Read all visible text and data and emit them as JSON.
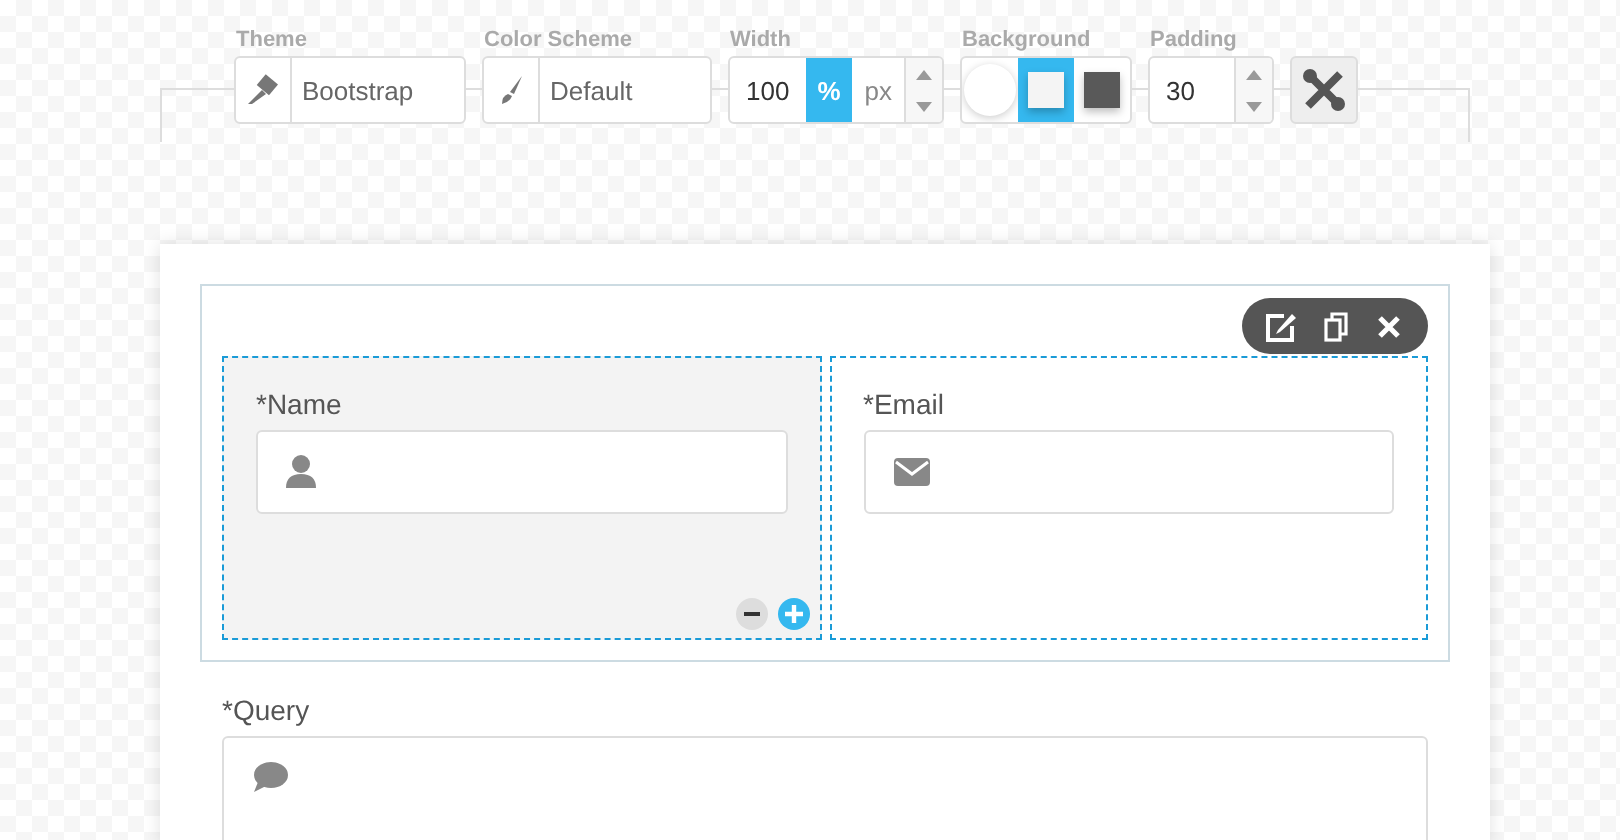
{
  "toolbar": {
    "theme": {
      "label": "Theme",
      "value": "Bootstrap"
    },
    "color_scheme": {
      "label": "Color Scheme",
      "value": "Default"
    },
    "width": {
      "label": "Width",
      "value": "100",
      "units": [
        {
          "label": "%",
          "selected": true
        },
        {
          "label": "px",
          "selected": false
        }
      ]
    },
    "background": {
      "label": "Background",
      "options": [
        {
          "kind": "circle",
          "color": "#ffffff",
          "selected": false
        },
        {
          "kind": "square",
          "color": "#f4f4f4",
          "selected": true
        },
        {
          "kind": "square",
          "color": "#595959",
          "selected": false
        }
      ]
    },
    "padding": {
      "label": "Padding",
      "value": "30"
    }
  },
  "form": {
    "row": {
      "columns": [
        {
          "selected": true,
          "field": {
            "kind": "user",
            "label": "*Name"
          }
        },
        {
          "selected": false,
          "field": {
            "kind": "email",
            "label": "*Email"
          }
        }
      ]
    },
    "query": {
      "kind": "comment",
      "label": "*Query"
    }
  }
}
